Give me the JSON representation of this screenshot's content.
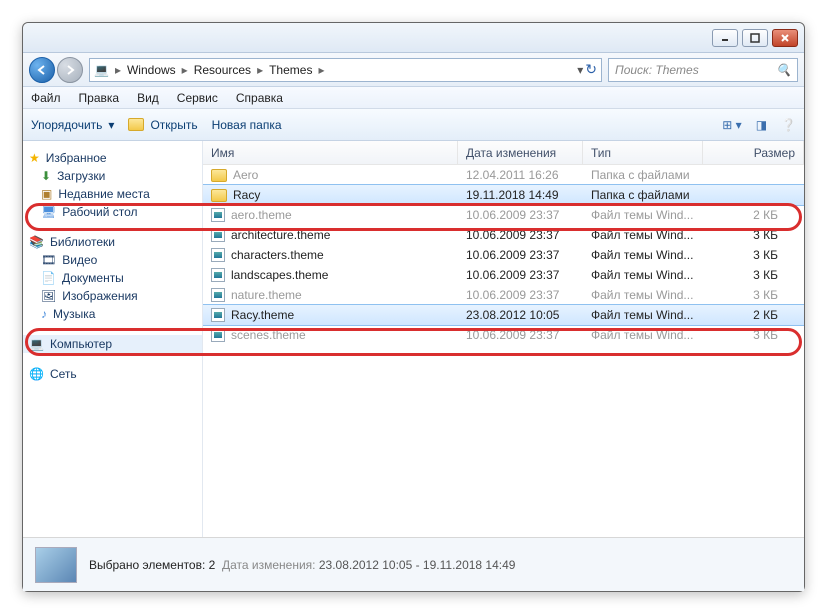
{
  "title": {
    "minimize": "_",
    "maximize": "□",
    "close": "×"
  },
  "nav": {
    "crumbs": [
      "Windows",
      "Resources",
      "Themes"
    ],
    "refresh": "⟳",
    "search_placeholder": "Поиск: Themes"
  },
  "menus": [
    "Файл",
    "Правка",
    "Вид",
    "Сервис",
    "Справка"
  ],
  "toolbar": {
    "organize": "Упорядочить",
    "open": "Открыть",
    "newfolder": "Новая папка"
  },
  "sidebar": {
    "fav": {
      "head": "Избранное",
      "items": [
        "Загрузки",
        "Недавние места",
        "Рабочий стол"
      ]
    },
    "lib": {
      "head": "Библиотеки",
      "items": [
        "Видео",
        "Документы",
        "Изображения",
        "Музыка"
      ]
    },
    "computer": "Компьютер",
    "network": "Сеть"
  },
  "columns": {
    "name": "Имя",
    "date": "Дата изменения",
    "type": "Тип",
    "size": "Размер"
  },
  "rows": [
    {
      "name": "Aero",
      "date": "12.04.2011 16:26",
      "type": "Папка с файлами",
      "size": "",
      "icon": "folder",
      "sel": false,
      "faded": true
    },
    {
      "name": "Racy",
      "date": "19.11.2018 14:49",
      "type": "Папка с файлами",
      "size": "",
      "icon": "folder",
      "sel": true,
      "faded": false
    },
    {
      "name": "aero.theme",
      "date": "10.06.2009 23:37",
      "type": "Файл темы Wind...",
      "size": "2 КБ",
      "icon": "theme",
      "sel": false,
      "faded": true
    },
    {
      "name": "architecture.theme",
      "date": "10.06.2009 23:37",
      "type": "Файл темы Wind...",
      "size": "3 КБ",
      "icon": "theme",
      "sel": false,
      "faded": false
    },
    {
      "name": "characters.theme",
      "date": "10.06.2009 23:37",
      "type": "Файл темы Wind...",
      "size": "3 КБ",
      "icon": "theme",
      "sel": false,
      "faded": false
    },
    {
      "name": "landscapes.theme",
      "date": "10.06.2009 23:37",
      "type": "Файл темы Wind...",
      "size": "3 КБ",
      "icon": "theme",
      "sel": false,
      "faded": false
    },
    {
      "name": "nature.theme",
      "date": "10.06.2009 23:37",
      "type": "Файл темы Wind...",
      "size": "3 КБ",
      "icon": "theme",
      "sel": false,
      "faded": true
    },
    {
      "name": "Racy.theme",
      "date": "23.08.2012 10:05",
      "type": "Файл темы Wind...",
      "size": "2 КБ",
      "icon": "theme",
      "sel": true,
      "faded": false
    },
    {
      "name": "scenes.theme",
      "date": "10.06.2009 23:37",
      "type": "Файл темы Wind...",
      "size": "3 КБ",
      "icon": "theme",
      "sel": false,
      "faded": true
    }
  ],
  "status": {
    "selected": "Выбрано элементов: 2",
    "datelabel": "Дата изменения:",
    "daterange": "23.08.2012 10:05 - 19.11.2018 14:49"
  }
}
